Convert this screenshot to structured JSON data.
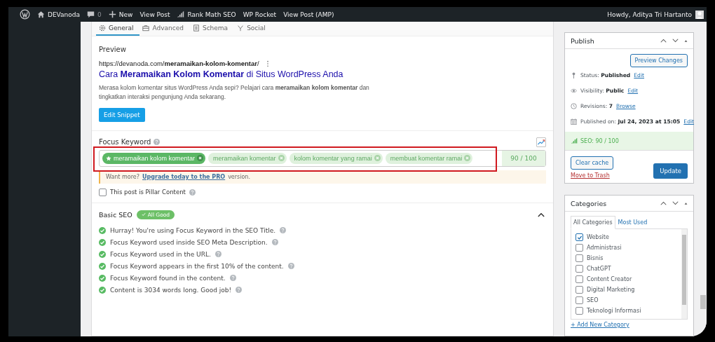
{
  "admin_bar": {
    "items": [
      {
        "kind": "logo"
      },
      {
        "kind": "home",
        "label": "DEVanoda"
      },
      {
        "kind": "comments",
        "label": "0"
      },
      {
        "kind": "new",
        "label": "New"
      },
      {
        "kind": "text",
        "label": "View Post"
      },
      {
        "kind": "rankmath",
        "label": "Rank Math SEO"
      },
      {
        "kind": "text",
        "label": "WP Rocket"
      },
      {
        "kind": "text",
        "label": "View Post (AMP)"
      }
    ],
    "greeting": "Howdy, Aditya Tri Hartanto"
  },
  "tabs": [
    {
      "label": "General",
      "selected": true
    },
    {
      "label": "Advanced",
      "selected": false
    },
    {
      "label": "Schema",
      "selected": false
    },
    {
      "label": "Social",
      "selected": false
    }
  ],
  "preview": {
    "heading": "Preview",
    "url": "https://devanoda.com/**meramaikan-kolom-komentar**/",
    "title": "Cara **Meramaikan Kolom Komentar** di Situs WordPress Anda",
    "description": "Merasa kolom komentar situs WordPress Anda sepi? Pelajari cara **meramaikan kolom komentar** dan tingkatkan interaksi pengunjung Anda sekarang.",
    "button": "Edit Snippet"
  },
  "focus_keyword": {
    "label": "Focus Keyword",
    "keywords": [
      {
        "text": "meramaikan kolom komentar",
        "primary": true
      },
      {
        "text": "meramaikan komentar",
        "primary": false
      },
      {
        "text": "kolom komentar yang ramai",
        "primary": false
      },
      {
        "text": "membuat komentar ramai",
        "primary": false
      }
    ],
    "score": "90 / 100",
    "highlighted": true,
    "upsell": {
      "before": "Want more?",
      "link": "Upgrade today to the PRO",
      "after": "version."
    },
    "pillar": {
      "label": "This post is Pillar Content",
      "checked": false
    }
  },
  "basic_seo": {
    "title": "Basic SEO",
    "badge": "All Good",
    "expanded": true,
    "checks": [
      {
        "text": "Hurray! You're using Focus Keyword in the SEO Title.",
        "passed": true
      },
      {
        "text": "Focus Keyword used inside SEO Meta Description.",
        "passed": true
      },
      {
        "text": "Focus Keyword used in the URL.",
        "passed": true
      },
      {
        "text": "Focus Keyword appears in the first 10% of the content.",
        "passed": true
      },
      {
        "text": "Focus Keyword found in the content.",
        "passed": true
      },
      {
        "text": "Content is 3034 words long. Good job!",
        "passed": true
      }
    ]
  },
  "publish": {
    "title": "Publish",
    "preview_button": "Preview Changes",
    "rows": [
      {
        "kind": "status",
        "text": "Status: **Published**",
        "link": "Edit"
      },
      {
        "kind": "visibility",
        "text": "Visibility: **Public**",
        "link": "Edit"
      },
      {
        "kind": "revisions",
        "text": "Revisions: **7**",
        "link": "Browse"
      },
      {
        "kind": "date",
        "text": "Published on: **Jul 24, 2023 at 15:05**",
        "link": "Edit"
      }
    ],
    "seo": "SEO: 90 / 100",
    "clear_cache": "Clear cache",
    "trash": "Move to Trash",
    "update": "Update"
  },
  "categories": {
    "title": "Categories",
    "tabs": [
      {
        "label": "All Categories",
        "selected": true
      },
      {
        "label": "Most Used",
        "selected": false
      }
    ],
    "items": [
      {
        "label": "Website",
        "checked": true
      },
      {
        "label": "Administrasi",
        "checked": false
      },
      {
        "label": "Bisnis",
        "checked": false
      },
      {
        "label": "ChatGPT",
        "checked": false
      },
      {
        "label": "Content Creator",
        "checked": false
      },
      {
        "label": "Digital Marketing",
        "checked": false
      },
      {
        "label": "SEO",
        "checked": false
      },
      {
        "label": "Teknologi Informasi",
        "checked": false
      }
    ],
    "add_link": "+ Add New Category"
  }
}
